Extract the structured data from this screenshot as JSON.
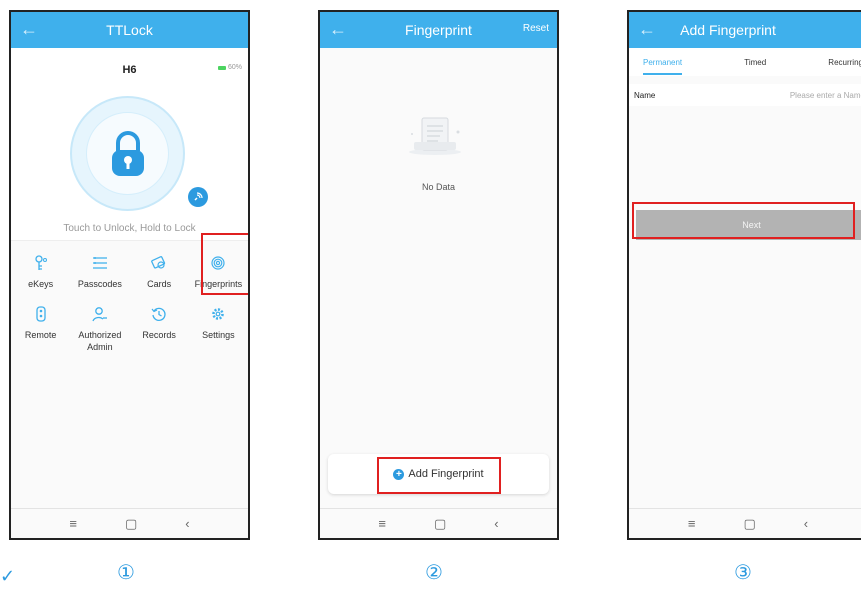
{
  "screen1": {
    "title": "TTLock",
    "back_icon": "arrow-left-icon",
    "lock_name": "H6",
    "battery": "60%",
    "hint": "Touch to Unlock, Hold to Lock",
    "features": [
      {
        "label": "eKeys",
        "icon": "ekey-icon"
      },
      {
        "label": "Passcodes",
        "icon": "passcode-icon"
      },
      {
        "label": "Cards",
        "icon": "card-icon"
      },
      {
        "label": "Fingerprints",
        "icon": "fingerprint-icon"
      },
      {
        "label": "Remote",
        "icon": "remote-icon"
      },
      {
        "label": "Authorized Admin",
        "icon": "admin-icon"
      },
      {
        "label": "Records",
        "icon": "records-icon"
      },
      {
        "label": "Settings",
        "icon": "settings-icon"
      }
    ]
  },
  "screen2": {
    "title": "Fingerprint",
    "reset": "Reset",
    "empty_text": "No Data",
    "add_button": "Add Fingerprint"
  },
  "screen3": {
    "title": "Add Fingerprint",
    "tabs": [
      "Permanent",
      "Timed",
      "Recurring"
    ],
    "name_label": "Name",
    "name_placeholder": "Please enter a Name",
    "next": "Next"
  },
  "nav": {
    "menu": "≡",
    "home": "▢",
    "back": "‹"
  },
  "steps": [
    "①",
    "②",
    "③"
  ],
  "colors": {
    "accent": "#3fb0ec",
    "highlight": "#e02020",
    "battery": "#4cd460"
  }
}
